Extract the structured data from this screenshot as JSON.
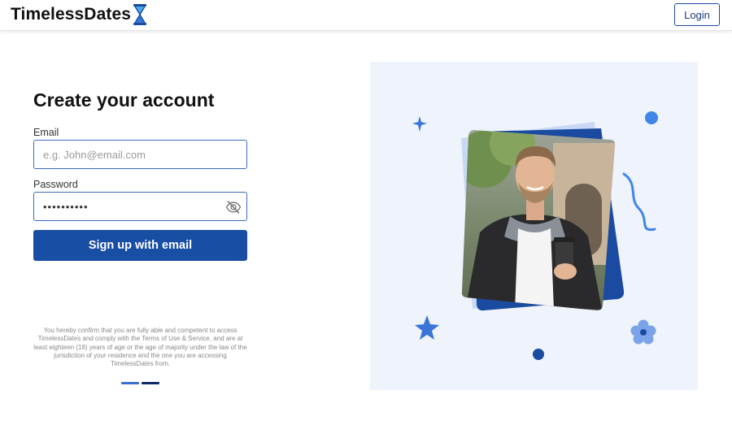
{
  "header": {
    "logo_text": "TimelessDates",
    "login_label": "Login"
  },
  "form": {
    "title": "Create your account",
    "email_label": "Email",
    "email_placeholder": "e.g. John@email.com",
    "password_label": "Password",
    "password_value": "••••••••••",
    "signup_label": "Sign up with email"
  },
  "terms_text": "You hereby confirm that you are fully able and competent to access TimelessDates and comply with the Terms of Use & Service, and are at least eighteen (18) years of age or the age of majority under the law of the jurisdiction of your residence and the one you are accessing TimelessDates from.",
  "icons": {
    "logo": "hourglass-icon",
    "password_toggle": "eye-slash-icon"
  },
  "colors": {
    "brand_blue": "#184ea3",
    "accent_blue": "#4a86e8",
    "panel_bg": "#eef3fc",
    "dot_active": "#3a6fd0",
    "dot_inactive": "#0e2a66"
  }
}
